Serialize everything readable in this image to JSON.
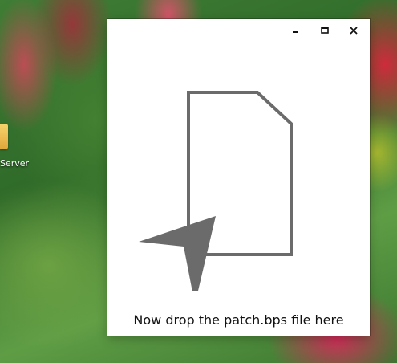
{
  "desktop": {
    "icon_label": "Server"
  },
  "window": {
    "controls": {
      "minimize_icon": "minimize-icon",
      "maximize_icon": "maximize-icon",
      "close_icon": "close-icon"
    },
    "drop_zone": {
      "instruction": "Now drop the patch.bps file here",
      "file_icon": "document-icon",
      "cursor_icon": "cursor-arrow-icon",
      "art_color": "#6b6b6b"
    }
  }
}
